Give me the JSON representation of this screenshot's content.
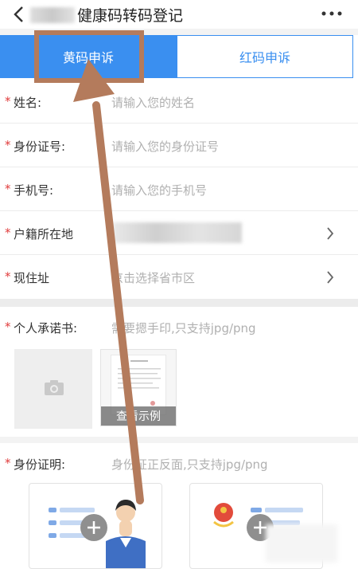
{
  "header": {
    "title": "健康码转码登记",
    "more": "•••"
  },
  "tabs": [
    {
      "label": "黄码申诉",
      "active": true
    },
    {
      "label": "红码申诉",
      "active": false
    }
  ],
  "form": {
    "required_mark": "*",
    "name": {
      "label": "姓名:",
      "placeholder": "请输入您的姓名"
    },
    "id_number": {
      "label": "身份证号:",
      "placeholder": "请输入您的身份证号"
    },
    "phone": {
      "label": "手机号:",
      "placeholder": "请输入您的手机号"
    },
    "hukou": {
      "label": "户籍所在地"
    },
    "address": {
      "label": "现住址",
      "placeholder": "京击选择省市区"
    }
  },
  "commitment": {
    "label": "个人承诺书:",
    "hint": "需要摁手印,只支持jpg/png",
    "sample_label": "查看示例"
  },
  "identity": {
    "label": "身份证明:",
    "hint": "身份证正反面,只支持jpg/png"
  },
  "colors": {
    "accent": "#3a8ff0",
    "required": "#e03b3b",
    "annotation": "#b47b5c"
  }
}
